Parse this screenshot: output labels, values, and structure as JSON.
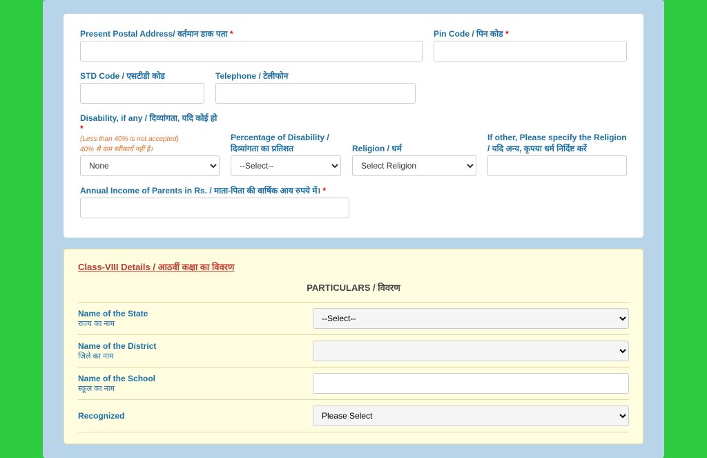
{
  "form": {
    "postal_address": {
      "label_en": "Present Postal Address/ वर्तमान डाक पता",
      "required": "*",
      "value": ""
    },
    "pin_code": {
      "label_en": "Pin Code / पिन कोड",
      "required": "*",
      "value": ""
    },
    "std_code": {
      "label_en": "STD Code / एसटीडी कोड",
      "value": ""
    },
    "telephone": {
      "label_en": "Telephone / टेलीफोन",
      "value": ""
    },
    "disability": {
      "label_en": "Disability, if any / दिव्यांगता, यदि कोई हो",
      "required": "*",
      "warning_en": "(Less than 40% is not accepted)",
      "warning_hi": "40% से कम स्वीकार्य नहीं है।",
      "options": [
        "None"
      ],
      "selected": "None"
    },
    "percentage_disability": {
      "label_en": "Percentage of Disability /",
      "label_en2": "दिव्यांगता का प्रतिशत",
      "options": [
        "--Select--"
      ],
      "selected": "--Select--"
    },
    "religion": {
      "label_en": "Religion / धर्म",
      "required": "*",
      "options": [
        "Select Religion"
      ],
      "selected": "Select Religion"
    },
    "other_religion": {
      "label_en": "If other, Please specify the Religion /",
      "label_en2": "यदि अन्य, कृपया धर्म निर्दिष्ट करें",
      "value": ""
    },
    "annual_income": {
      "label_en": "Annual Income of Parents in Rs. / माता-पिता की वार्षिक आय रुपये में।",
      "required": "*",
      "value": ""
    }
  },
  "class8": {
    "section_title": "Class-VIII Details / आठवीं कक्षा का विवरण",
    "particulars_header": "PARTICULARS / विवरण",
    "state": {
      "label_en": "Name of the State",
      "label_hi": "राज्य का नाम",
      "required": "*",
      "options": [
        "--Select--"
      ],
      "selected": "--Select--"
    },
    "district": {
      "label_en": "Name of the District",
      "label_hi": "जिले का नाम",
      "required": "*",
      "options": [
        ""
      ],
      "selected": ""
    },
    "school": {
      "label_en": "Name of the School",
      "label_hi": "स्कूल का नाम",
      "required": "*",
      "value": ""
    },
    "recognized": {
      "label_en": "Recognized",
      "options": [
        "Please Select"
      ],
      "selected": "Please Select"
    }
  }
}
